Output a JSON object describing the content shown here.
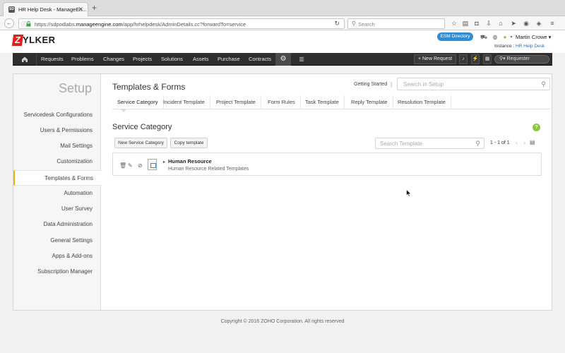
{
  "browser": {
    "tab_title": "HR Help Desk - ManageEn...",
    "tab_favicon": "SD",
    "new_tab": "+",
    "url_prefix": "https://sdpodlabs.",
    "url_domain": "manageengine.com",
    "url_path": "/app/hrhelpdesk/AdminDetails.cc?forwardTo=service",
    "search_placeholder": "Search"
  },
  "header": {
    "logo_first": "Z",
    "logo_rest": "YLKER",
    "esm_directory": "ESM Directory",
    "user_name": "Martin Crowe",
    "instance_label": "Instance :",
    "instance_value": "HR Help Desk"
  },
  "menu": {
    "items": [
      "Requests",
      "Problems",
      "Changes",
      "Projects",
      "Solutions",
      "Assets",
      "Purchase",
      "Contracts"
    ],
    "new_request": "+ New Request",
    "requester_search": "Requester"
  },
  "sidebar": {
    "title": "Setup",
    "items": [
      "Servicedesk Configurations",
      "Users & Permissions",
      "Mail Settings",
      "Customization",
      "Templates & Forms",
      "Automation",
      "User Survey",
      "Data Administration",
      "General Settings",
      "Apps & Add-ons",
      "Subscription Manager"
    ],
    "active_index": 4
  },
  "content": {
    "title": "Templates & Forms",
    "getting_started": "Getting Started",
    "separator": "|",
    "search_setup_placeholder": "Search in Setup",
    "tabs": [
      "Service Category",
      "Incident Template",
      "Project Template",
      "Form Rules",
      "Task Template",
      "Reply Template",
      "Resolution Template"
    ],
    "active_tab": 0,
    "section_title": "Service Category",
    "help": "?",
    "buttons": {
      "new_service_category": "New Service Category",
      "copy_template": "Copy template"
    },
    "search_template_placeholder": "Search Template",
    "pager": "1 - 1 of 1",
    "templates": [
      {
        "name": "Human Resource",
        "description": "Human Resource Related Templates"
      }
    ]
  },
  "footer": {
    "copyright": "Copyright © 2016 ZOHO Corporation. All rights reserved"
  },
  "colors": {
    "accent_blue": "#2d8dd8",
    "brand_red": "#e0201b",
    "menubar": "#2e2e2e",
    "active_marker": "#f0b400",
    "help_green": "#8cc63f"
  }
}
